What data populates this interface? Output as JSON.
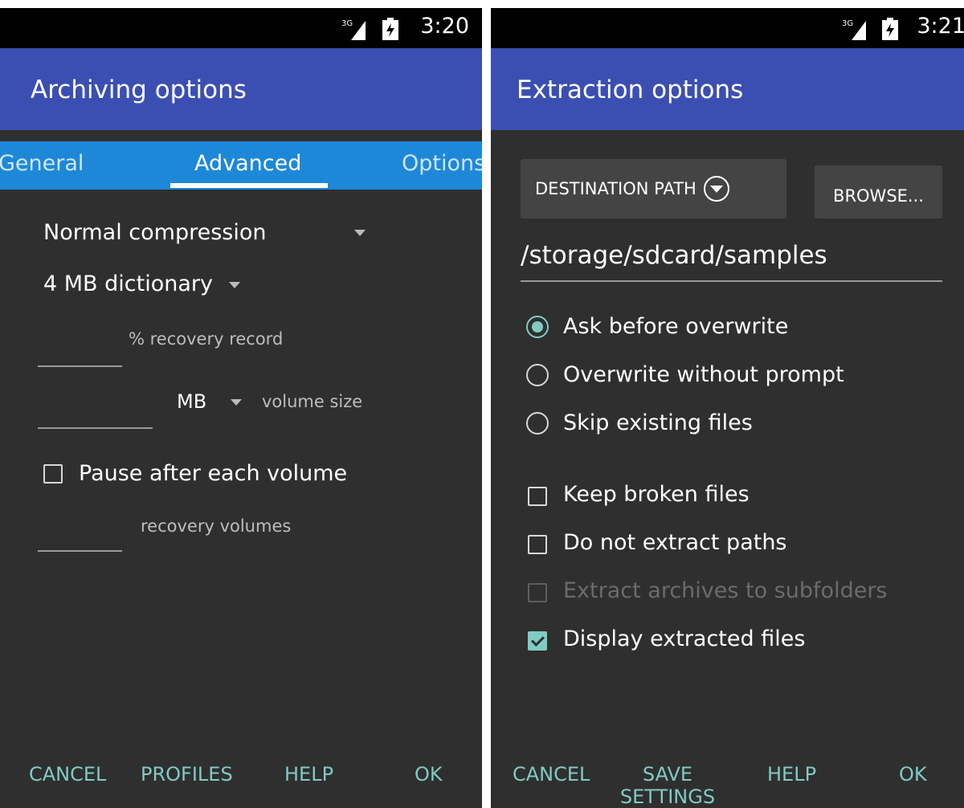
{
  "left": {
    "status_time": "3:20",
    "network_type": "3G",
    "title": "Archiving options",
    "tabs": [
      {
        "label": "General",
        "active": false
      },
      {
        "label": "Advanced",
        "active": true
      },
      {
        "label": "Options",
        "active": false
      }
    ],
    "compression": "Normal compression",
    "dictionary": "4 MB dictionary",
    "recovery_percent_label": "% recovery record",
    "volume_unit": "MB",
    "volume_size_label": "volume size",
    "pause_label": "Pause after each volume",
    "recovery_volumes_label": "recovery volumes",
    "footer": {
      "cancel": "CANCEL",
      "profiles": "PROFILES",
      "help": "HELP",
      "ok": "OK"
    }
  },
  "right": {
    "status_time": "3:21",
    "network_type": "3G",
    "title": "Extraction options",
    "destination_label": "DESTINATION PATH",
    "browse_label": "BROWSE...",
    "path": "/storage/sdcard/samples",
    "radios": [
      {
        "label": "Ask before overwrite",
        "selected": true
      },
      {
        "label": "Overwrite without prompt",
        "selected": false
      },
      {
        "label": "Skip existing files",
        "selected": false
      }
    ],
    "checkboxes": [
      {
        "label": "Keep broken files",
        "checked": false,
        "disabled": false
      },
      {
        "label": "Do not extract paths",
        "checked": false,
        "disabled": false
      },
      {
        "label": "Extract archives to subfolders",
        "checked": false,
        "disabled": true
      },
      {
        "label": "Display extracted files",
        "checked": true,
        "disabled": false
      }
    ],
    "footer": {
      "cancel": "CANCEL",
      "save_line1": "SAVE",
      "save_line2": "SETTINGS",
      "help": "HELP",
      "ok": "OK"
    }
  },
  "colors": {
    "app_bar": "#3b4fb3",
    "tab_bar": "#1e88d8",
    "accent": "#80cbc4",
    "background": "#2f2f2f"
  }
}
